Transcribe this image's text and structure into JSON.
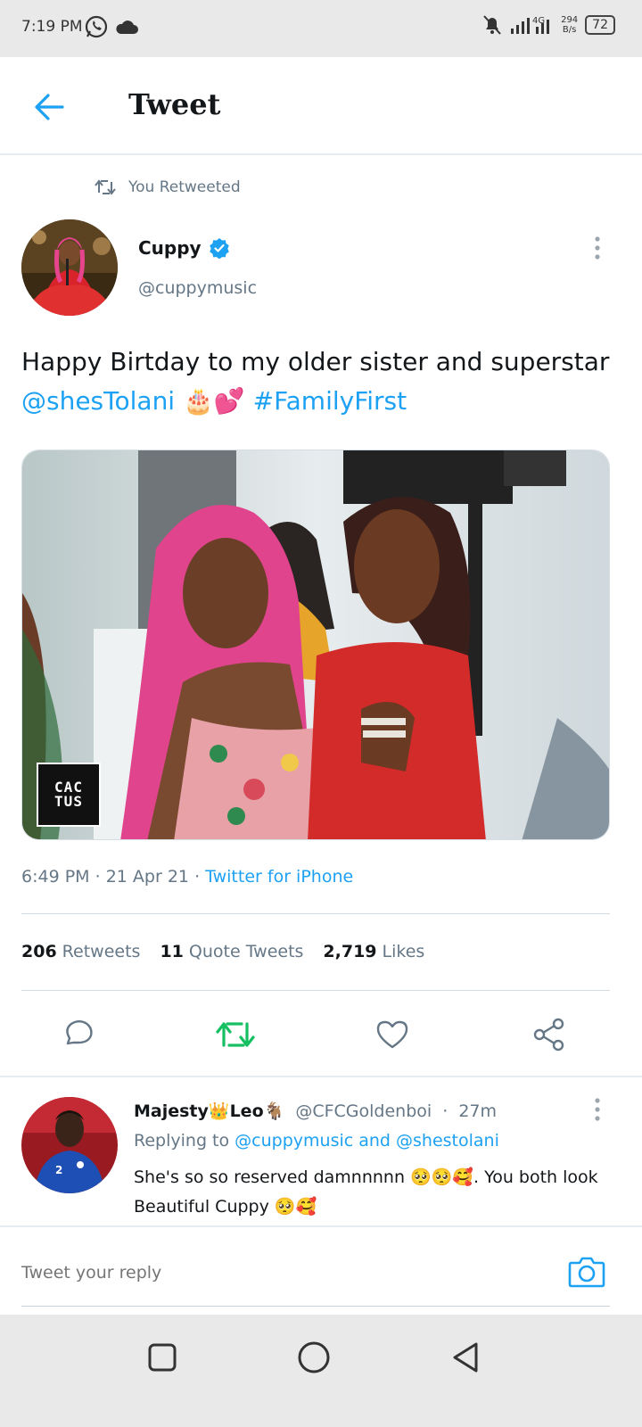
{
  "status_bar": {
    "time": "7:19 PM",
    "network_type": "4G",
    "speed_value": "294",
    "speed_unit": "B/s",
    "battery": "72",
    "icons": [
      "whatsapp-icon",
      "cloud-icon",
      "mute-icon",
      "signal-icon"
    ]
  },
  "header": {
    "title": "Tweet"
  },
  "retweet_banner": {
    "label": "You Retweeted"
  },
  "tweet": {
    "author_name": "Cuppy",
    "author_handle": "@cuppymusic",
    "text_plain": "Happy Birtday to my older sister and superstar",
    "mention": "@shesTolani",
    "emojis": "🎂💕",
    "hashtag": "#FamilyFirst",
    "photo_watermark_top": "CAC",
    "photo_watermark_bottom": "TUS",
    "time": "6:49 PM",
    "date": "21 Apr 21",
    "source": "Twitter for iPhone",
    "separator": "·",
    "retweets_count": "206",
    "retweets_label": "Retweets",
    "quotes_count": "11",
    "quotes_label": "Quote Tweets",
    "likes_count": "2,719",
    "likes_label": "Likes"
  },
  "reply": {
    "name_part1": "Majesty",
    "name_emoji1": "👑",
    "name_part2": "Leo",
    "name_emoji2": "🐐",
    "handle": "@CFCGoldenboi",
    "time": "27m",
    "replying_prefix": "Replying to",
    "replying_targets": "@cuppymusic and @shestolani",
    "text": "She's so so reserved damnnnnn 🥺🥺🥰. You both look Beautiful Cuppy 🥺🥰"
  },
  "composer": {
    "placeholder": "Tweet your reply"
  },
  "colors": {
    "accent": "#1da1f2",
    "retweet_active": "#17bf63",
    "secondary_text": "#657786"
  }
}
